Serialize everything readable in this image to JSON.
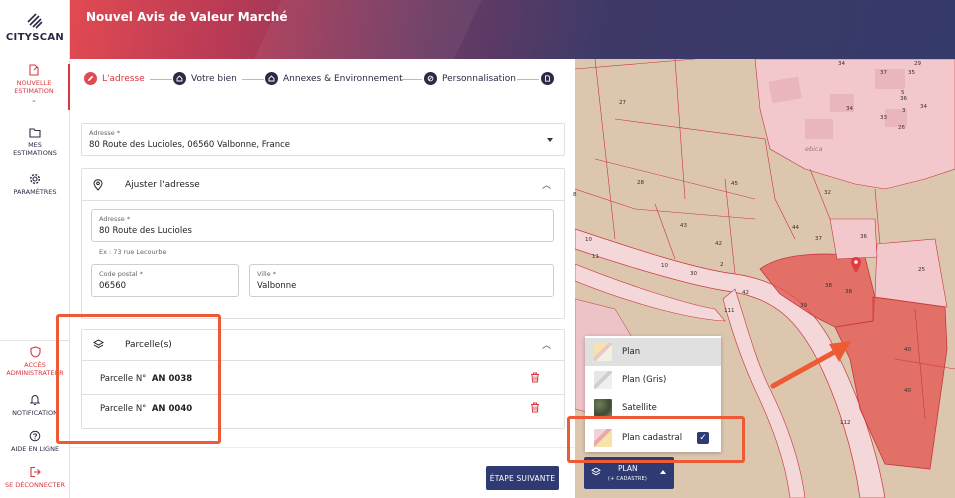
{
  "app": {
    "logo_text": "CITYSCAN",
    "page_title": "Nouvel Avis de Valeur Marché"
  },
  "sidebar": {
    "items": [
      {
        "label_line1": "NOUVELLE",
        "label_line2": "ESTIMATION",
        "icon": "new-document-icon",
        "active": true
      },
      {
        "label_line1": "MES",
        "label_line2": "ESTIMATIONS",
        "icon": "folder-icon"
      },
      {
        "label_line1": "PARAMÈTRES",
        "icon": "gear-icon"
      }
    ],
    "bottom_items": [
      {
        "label_line1": "ACCÈS",
        "label_line2": "ADMINISTRATEUR",
        "icon": "shield-icon"
      },
      {
        "label_line1": "NOTIFICATION",
        "icon": "bell-icon"
      },
      {
        "label_line1": "AIDE EN LIGNE",
        "icon": "help-icon"
      },
      {
        "label_line1": "SE DÉCONNECTER",
        "icon": "logout-icon"
      }
    ]
  },
  "stepper": {
    "steps": [
      {
        "label": "L'adresse",
        "icon": "pencil-icon",
        "active": true
      },
      {
        "label": "Votre bien",
        "icon": "home-icon"
      },
      {
        "label": "Annexes & Environnement",
        "icon": "home-icon"
      },
      {
        "label": "Personnalisation",
        "icon": "edit-icon"
      },
      {
        "label": "",
        "icon": "document-icon"
      }
    ]
  },
  "address_select": {
    "label": "Adresse *",
    "value": "80 Route des Lucioles, 06560 Valbonne, France"
  },
  "adjust_section": {
    "title": "Ajuster l'adresse",
    "address_label": "Adresse *",
    "address_value": "80 Route des Lucioles",
    "address_helper": "Ex : 73 rue Lecourbe",
    "postal_label": "Code postal *",
    "postal_value": "06560",
    "city_label": "Ville *",
    "city_value": "Valbonne"
  },
  "parcels_section": {
    "title": "Parcelle(s)",
    "prefix": "Parcelle N°",
    "rows": [
      {
        "id": "AN 0038"
      },
      {
        "id": "AN 0040"
      }
    ]
  },
  "next_button": "ÉTAPE SUIVANTE",
  "map": {
    "layers": [
      {
        "label": "Plan",
        "selected": true
      },
      {
        "label": "Plan (Gris)"
      },
      {
        "label": "Satellite"
      },
      {
        "label": "Plan cadastral",
        "checked": true
      }
    ],
    "layer_button_label": "PLAN",
    "layer_button_sub": "(+ CADASTRE)",
    "place_label": "ebica",
    "parcel_numbers": [
      "27",
      "28",
      "45",
      "43",
      "42",
      "44",
      "37",
      "36",
      "32",
      "25",
      "10",
      "2",
      "30",
      "42",
      "38",
      "38",
      "39",
      "111",
      "40",
      "40",
      "112",
      "34",
      "37",
      "35",
      "36",
      "34",
      "34",
      "33",
      "5",
      "3",
      "26",
      "29",
      "8",
      "10",
      "11"
    ],
    "colors": {
      "accent": "#e14a52",
      "primary": "#2f3a72",
      "highlight": "#ee5a34",
      "parcel_fill": "#e4534f"
    }
  }
}
